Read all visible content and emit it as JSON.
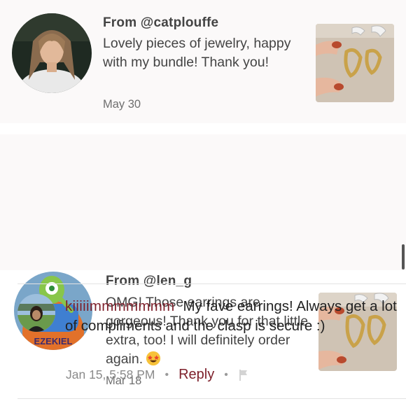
{
  "reviews": [
    {
      "from": "From @catplouffe",
      "text": "Lovely pieces of jewelry, happy with my bundle! Thank you!",
      "date": "May 30"
    },
    {
      "from": "From @len_g",
      "text": "OMG! Those earrings are gorgeous! Thank you for that little extra, too! I will definitely order again.",
      "date": "Mar 18",
      "avatar_caption": "EZEKIEL"
    }
  ],
  "comment": {
    "username": "kiiiiimmmmmmm",
    "text": "My fave earrings! Always get a lot of compliments and the clasp is secure :)",
    "timestamp": "Jan 15, 5:58 PM",
    "separator": "•",
    "reply_label": "Reply"
  },
  "colors": {
    "accent": "#7d1f2a",
    "card_bg": "#fbf9f9",
    "text": "#444444",
    "muted": "#6f6f6f"
  },
  "icons": [
    "smiling-face-with-starry-eyes-emoji",
    "flag-icon"
  ]
}
